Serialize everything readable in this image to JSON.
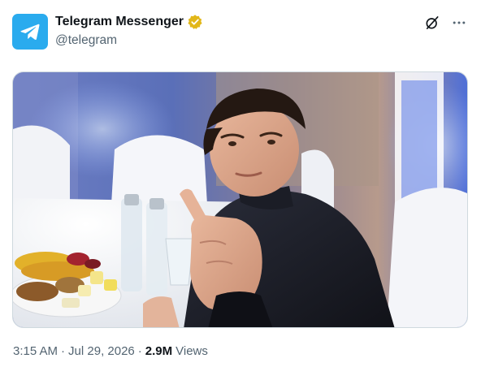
{
  "author": {
    "display_name": "Telegram Messenger",
    "handle": "@telegram",
    "verified_badge": "gold-verified-badge-icon",
    "avatar_icon": "telegram-paper-plane-icon",
    "avatar_color": "#2aabee",
    "badge_color": "#e2b719"
  },
  "actions": {
    "grok_icon": "grok-slash-circle-icon",
    "more_icon": "more-horizontal-icon"
  },
  "media": {
    "description_icon": "photo"
  },
  "meta": {
    "time": "3:15 AM",
    "dot1": "·",
    "date": "Jul 29, 2026",
    "dot2": "·",
    "views_count": "2.9M",
    "views_label": "Views"
  },
  "colors": {
    "text_primary": "#0f1419",
    "text_secondary": "#536471",
    "border": "#cfd9de"
  }
}
